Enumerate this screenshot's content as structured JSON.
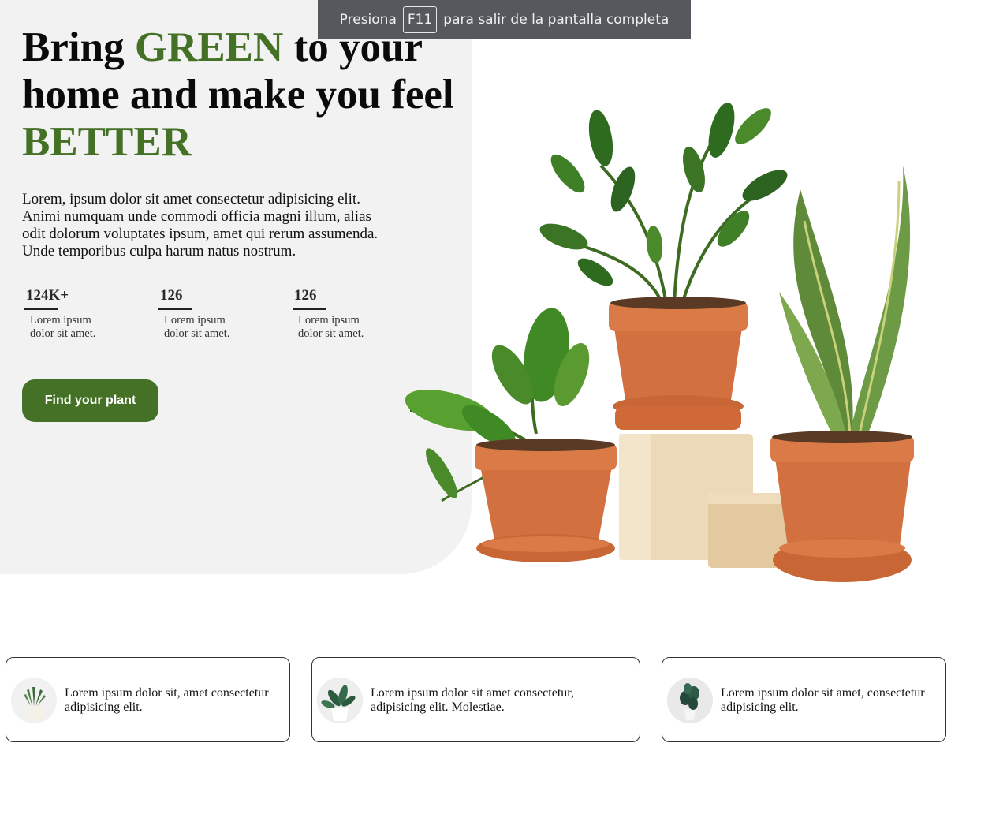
{
  "hero": {
    "headline": {
      "part1": "Bring ",
      "accent1": "GREEN",
      "part2": " to your home and make you feel ",
      "accent2": "BETTER"
    },
    "intro": "Lorem, ipsum dolor sit amet consectetur adipisicing elit. Animi numquam unde commodi officia magni illum, alias odit dolorum voluptates ipsum, amet qui rerum assumenda. Unde temporibus culpa harum natus nostrum.",
    "stats": [
      {
        "value": "124K+",
        "label": "Lorem ipsum dolor sit amet."
      },
      {
        "value": "126",
        "label": "Lorem ipsum dolor sit amet."
      },
      {
        "value": "126",
        "label": "Lorem ipsum dolor sit amet."
      }
    ],
    "cta_label": "Find your plant",
    "image_icon": "potted-plants-illustration"
  },
  "fullscreen_notice": {
    "prefix": "Presiona",
    "key": "F11",
    "suffix": "para salir de la pantalla completa"
  },
  "features": [
    {
      "icon": "succulent-plant-icon",
      "text": "Lorem ipsum dolor sit, amet consectetur adipisicing elit."
    },
    {
      "icon": "leafy-plant-icon",
      "text": "Lorem ipsum dolor sit amet consectetur, adipisicing elit. Molestiae."
    },
    {
      "icon": "fiddle-leaf-plant-icon",
      "text": "Lorem ipsum dolor sit amet, consectetur adipisicing elit."
    }
  ],
  "colors": {
    "accent": "#457126",
    "hero_bg": "#f2f2f2",
    "pot": "#d2703f",
    "notice_bg": "#55585c"
  }
}
